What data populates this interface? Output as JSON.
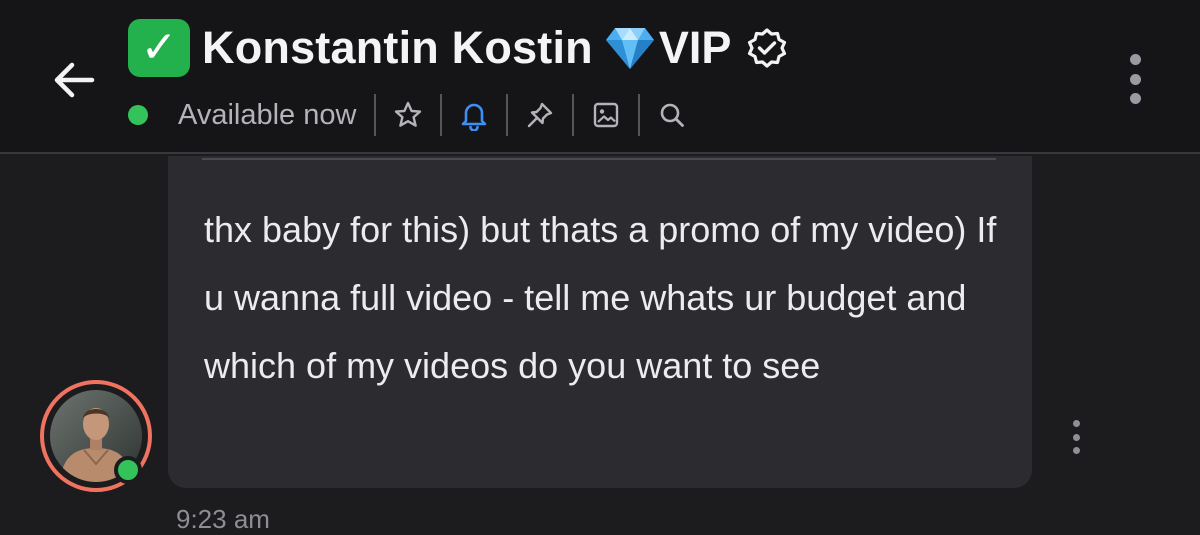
{
  "header": {
    "back_icon": "arrow-left-icon",
    "title_emoji_icon": "check-mark-button-icon",
    "name": "Konstantin Kostin",
    "diamond_icon": "gem-stone-icon",
    "vip_label": "VIP",
    "verified_icon": "verified-badge-icon",
    "status_text": "Available now",
    "status_color": "#34c35a",
    "tools": [
      {
        "icon": "star-icon"
      },
      {
        "icon": "bell-icon",
        "color": "#3d8ff6"
      },
      {
        "icon": "pin-icon"
      },
      {
        "icon": "image-icon"
      },
      {
        "icon": "search-icon"
      }
    ],
    "more_icon": "more-vertical-icon"
  },
  "message": {
    "text": "thx baby for this) but thats a promo of my video) If u wanna full video - tell me whats ur budget and which of my videos do you want to see",
    "time": "9:23 am",
    "avatar_ring_color": "#f07360",
    "more_icon": "more-vertical-icon"
  }
}
